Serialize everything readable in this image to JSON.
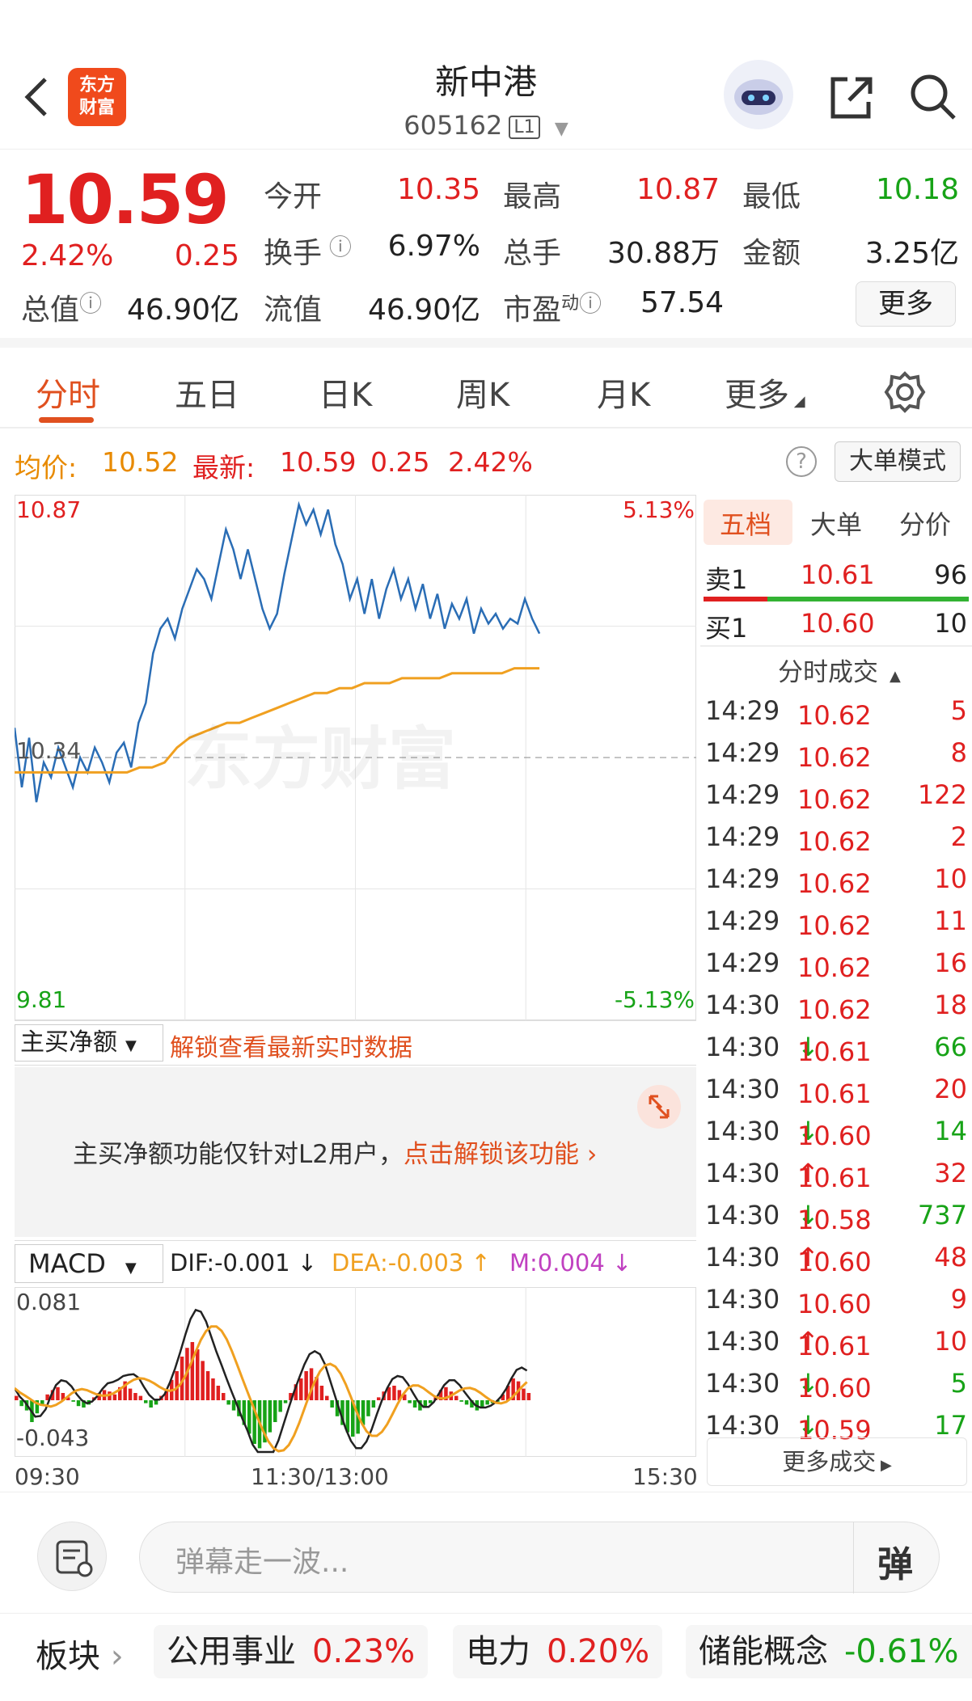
{
  "header": {
    "logo_text_1": "东方",
    "logo_text_2": "财富",
    "title": "新中港",
    "code": "605162",
    "level": "L1"
  },
  "quote": {
    "price": "10.59",
    "change_pct": "2.42%",
    "change": "0.25",
    "open_label": "今开",
    "open": "10.35",
    "high_label": "最高",
    "high": "10.87",
    "low_label": "最低",
    "low": "10.18",
    "turnover_label": "换手",
    "turnover": "6.97%",
    "volume_label": "总手",
    "volume": "30.88万",
    "amount_label": "金额",
    "amount": "3.25亿",
    "mktcap_label": "总值",
    "mktcap": "46.90亿",
    "float_label": "流值",
    "float": "46.90亿",
    "pe_label": "市盈",
    "pe_sup": "动",
    "pe": "57.54",
    "more": "更多"
  },
  "tabs": [
    "分时",
    "五日",
    "日K",
    "周K",
    "月K",
    "更多"
  ],
  "infobar": {
    "avg_label": "均价:",
    "avg": "10.52",
    "last_label": "最新:",
    "last": "10.59",
    "chg": "0.25",
    "pct": "2.42%",
    "help": "?",
    "mode_button": "大单模式"
  },
  "chart_labels": {
    "y_top": "10.87",
    "y_mid": "10.34",
    "y_bottom": "9.81",
    "pct_top": "5.13%",
    "pct_bottom": "-5.13%"
  },
  "chart_data": {
    "type": "line",
    "x_range": [
      "09:30",
      "15:30"
    ],
    "ylim": [
      9.81,
      10.87
    ],
    "series": [
      {
        "values": [
          10.4,
          10.28,
          10.38,
          10.25,
          10.33,
          10.3,
          10.36,
          10.32,
          10.28,
          10.34,
          10.31,
          10.36,
          10.33,
          10.29,
          10.35,
          10.37,
          10.32,
          10.41,
          10.45,
          10.55,
          10.6,
          10.62,
          10.58,
          10.64,
          10.68,
          10.72,
          10.7,
          10.66,
          10.73,
          10.8,
          10.76,
          10.7,
          10.76,
          10.7,
          10.64,
          10.6,
          10.63,
          10.71,
          10.78,
          10.85,
          10.81,
          10.84,
          10.79,
          10.84,
          10.77,
          10.73,
          10.66,
          10.7,
          10.63,
          10.7,
          10.62,
          10.68,
          10.72,
          10.66,
          10.7,
          10.64,
          10.69,
          10.62,
          10.67,
          10.6,
          10.65,
          10.62,
          10.66,
          10.59,
          10.64,
          10.61,
          10.63,
          10.6,
          10.62,
          10.61,
          10.66,
          10.62,
          10.59
        ]
      },
      {
        "values": [
          10.31,
          10.31,
          10.31,
          10.31,
          10.31,
          10.31,
          10.31,
          10.31,
          10.31,
          10.31,
          10.32,
          10.32,
          10.33,
          10.36,
          10.38,
          10.39,
          10.4,
          10.41,
          10.41,
          10.42,
          10.43,
          10.44,
          10.45,
          10.46,
          10.47,
          10.47,
          10.48,
          10.48,
          10.49,
          10.49,
          10.49,
          10.5,
          10.5,
          10.5,
          10.5,
          10.51,
          10.51,
          10.51,
          10.51,
          10.51,
          10.52,
          10.52,
          10.52
        ]
      }
    ]
  },
  "flow": {
    "selector": "主买净额",
    "unlock_hint": "解锁查看最新实时数据",
    "panel_text": "主买净额功能仅针对L2用户，",
    "panel_link": "点击解锁该功能"
  },
  "macd": {
    "selector": "MACD",
    "dif": "DIF:-0.001",
    "dea": "DEA:-0.003",
    "m": "M:0.004",
    "y_top": "0.081",
    "y_bottom": "-0.043"
  },
  "time_labels": [
    "09:30",
    "11:30/13:00",
    "15:30"
  ],
  "book": {
    "tabs": [
      "五档",
      "大单",
      "分价"
    ],
    "sell1": {
      "label": "卖1",
      "price": "10.61",
      "vol": "96"
    },
    "buy1": {
      "label": "买1",
      "price": "10.60",
      "vol": "10"
    },
    "trades_title": "分时成交",
    "trades": [
      {
        "t": "14:29",
        "p": "10.62",
        "d": "",
        "v": "5",
        "c": "red"
      },
      {
        "t": "14:29",
        "p": "10.62",
        "d": "",
        "v": "8",
        "c": "red"
      },
      {
        "t": "14:29",
        "p": "10.62",
        "d": "",
        "v": "122",
        "c": "red"
      },
      {
        "t": "14:29",
        "p": "10.62",
        "d": "",
        "v": "2",
        "c": "red"
      },
      {
        "t": "14:29",
        "p": "10.62",
        "d": "",
        "v": "10",
        "c": "red"
      },
      {
        "t": "14:29",
        "p": "10.62",
        "d": "",
        "v": "11",
        "c": "red"
      },
      {
        "t": "14:29",
        "p": "10.62",
        "d": "",
        "v": "16",
        "c": "red"
      },
      {
        "t": "14:30",
        "p": "10.62",
        "d": "",
        "v": "18",
        "c": "red"
      },
      {
        "t": "14:30",
        "p": "10.61",
        "d": "↓",
        "v": "66",
        "c": "green"
      },
      {
        "t": "14:30",
        "p": "10.61",
        "d": "",
        "v": "20",
        "c": "red"
      },
      {
        "t": "14:30",
        "p": "10.60",
        "d": "↓",
        "v": "14",
        "c": "green"
      },
      {
        "t": "14:30",
        "p": "10.61",
        "d": "↑",
        "v": "32",
        "c": "red"
      },
      {
        "t": "14:30",
        "p": "10.58",
        "d": "↓",
        "v": "737",
        "c": "green"
      },
      {
        "t": "14:30",
        "p": "10.60",
        "d": "↑",
        "v": "48",
        "c": "red"
      },
      {
        "t": "14:30",
        "p": "10.60",
        "d": "",
        "v": "9",
        "c": "red"
      },
      {
        "t": "14:30",
        "p": "10.61",
        "d": "↑",
        "v": "10",
        "c": "red"
      },
      {
        "t": "14:30",
        "p": "10.60",
        "d": "↓",
        "v": "5",
        "c": "green"
      },
      {
        "t": "14:30",
        "p": "10.59",
        "d": "↓",
        "v": "17",
        "c": "green"
      }
    ],
    "more_trades": "更多成交"
  },
  "comment": {
    "placeholder": "弹幕走一波...",
    "send": "弹"
  },
  "sectors": {
    "label": "板块",
    "items": [
      {
        "name": "公用事业",
        "pct": "0.23%"
      },
      {
        "name": "电力",
        "pct": "0.20%"
      },
      {
        "name": "储能概念",
        "pct": "-0.61%"
      }
    ]
  },
  "colors": {
    "up": "#e02020",
    "down": "#17a317",
    "accent": "#e0501f",
    "avg_line": "#f0a020",
    "price_line": "#2a6db5"
  }
}
